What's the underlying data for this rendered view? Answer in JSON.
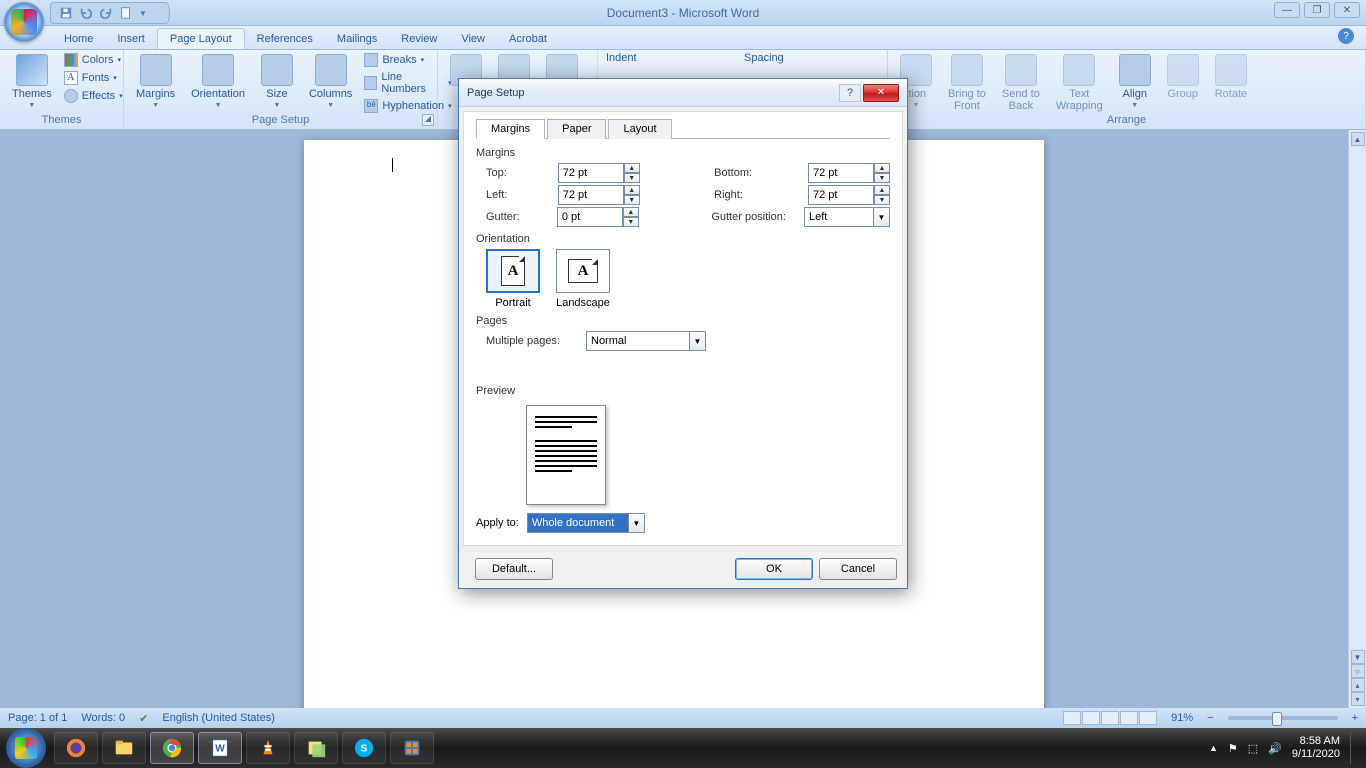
{
  "app_title": "Document3 - Microsoft Word",
  "window_buttons": {
    "min": "—",
    "max": "❐",
    "close": "✕"
  },
  "tabs": [
    "Home",
    "Insert",
    "Page Layout",
    "References",
    "Mailings",
    "Review",
    "View",
    "Acrobat"
  ],
  "active_tab": "Page Layout",
  "ribbon": {
    "themes": {
      "label": "Themes",
      "btn": "Themes",
      "colors": "Colors",
      "fonts": "Fonts",
      "effects": "Effects"
    },
    "pagesetup": {
      "label": "Page Setup",
      "margins": "Margins",
      "orientation": "Orientation",
      "size": "Size",
      "columns": "Columns",
      "breaks": "Breaks",
      "linenumbers": "Line Numbers",
      "hyphenation": "Hyphenation"
    },
    "indent_spacing": {
      "indent": "Indent",
      "spacing": "Spacing"
    },
    "arrange": {
      "label": "Arrange",
      "position_suffix": "ition",
      "bringfront": "Bring to\nFront",
      "sendback": "Send to\nBack",
      "textwrap": "Text\nWrapping",
      "align": "Align",
      "group": "Group",
      "rotate": "Rotate"
    }
  },
  "dialog": {
    "title": "Page Setup",
    "tabs": [
      "Margins",
      "Paper",
      "Layout"
    ],
    "active_tab": "Margins",
    "section_margins": "Margins",
    "top_lbl": "Top:",
    "top_val": "72 pt",
    "bottom_lbl": "Bottom:",
    "bottom_val": "72 pt",
    "left_lbl": "Left:",
    "left_val": "72 pt",
    "right_lbl": "Right:",
    "right_val": "72 pt",
    "gutter_lbl": "Gutter:",
    "gutter_val": "0 pt",
    "gutterpos_lbl": "Gutter position:",
    "gutterpos_val": "Left",
    "section_orientation": "Orientation",
    "portrait": "Portrait",
    "landscape": "Landscape",
    "section_pages": "Pages",
    "multipages_lbl": "Multiple pages:",
    "multipages_val": "Normal",
    "section_preview": "Preview",
    "applyto_lbl": "Apply to:",
    "applyto_val": "Whole document",
    "default_btn": "Default...",
    "ok_btn": "OK",
    "cancel_btn": "Cancel"
  },
  "statusbar": {
    "page": "Page: 1 of 1",
    "words": "Words: 0",
    "lang": "English (United States)",
    "zoom": "91%"
  },
  "taskbar": {
    "time": "8:58 AM",
    "date": "9/11/2020"
  }
}
